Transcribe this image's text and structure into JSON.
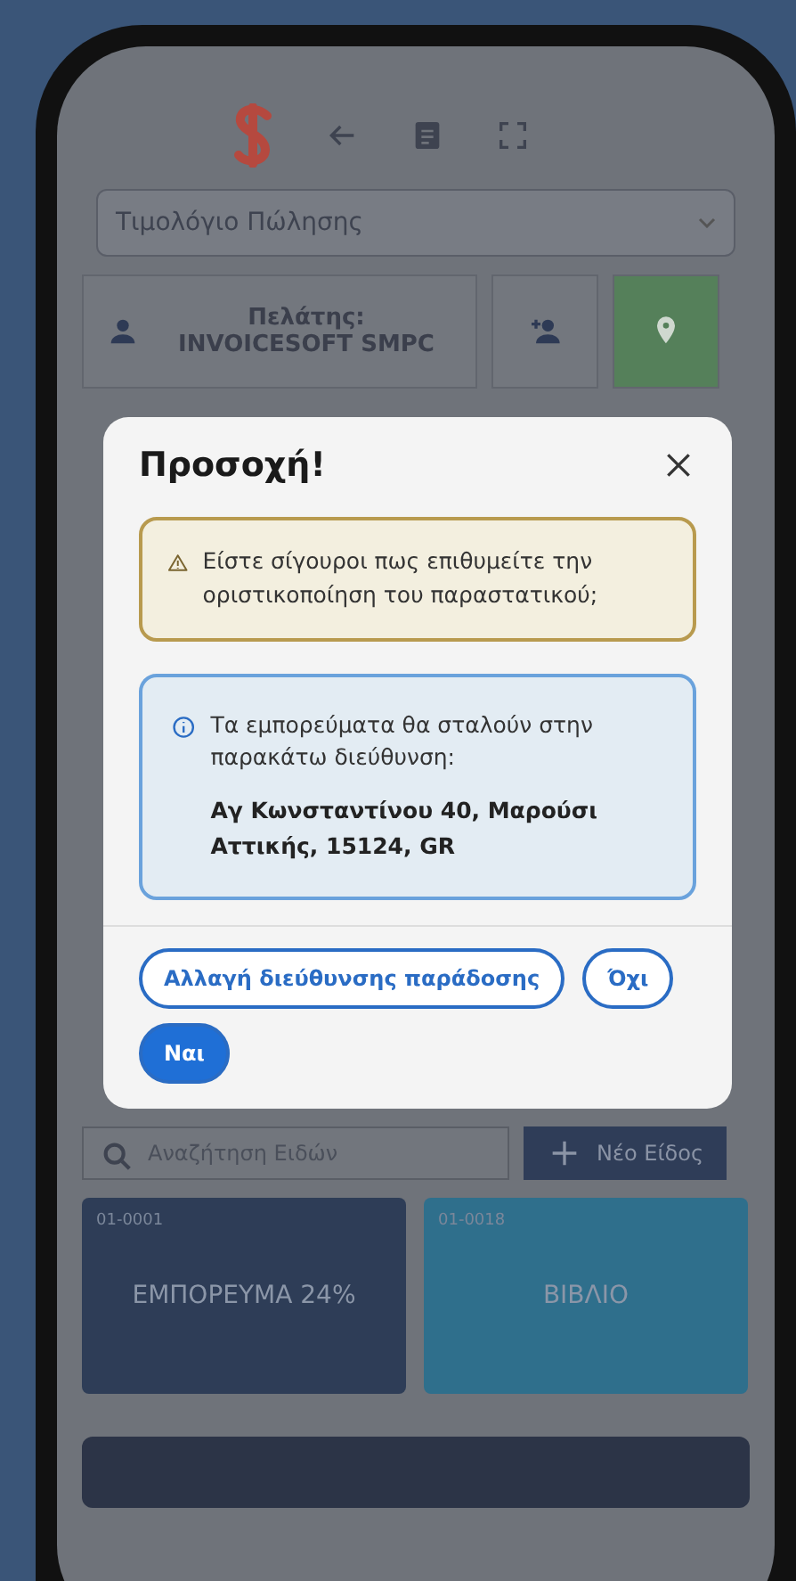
{
  "document_type": {
    "value": "Τιμολόγιο Πώλησης"
  },
  "customer": {
    "label": "Πελάτης: INVOICESOFT SMPC"
  },
  "dialog": {
    "title": "Προσοχή!",
    "warning": "Είστε σίγουροι πως επιθυμείτε την οριστικοποίηση του παραστατικού;",
    "info": "Τα εμπορεύματα θα σταλούν στην παρακάτω διεύθυνση:",
    "address": "Αγ Κωνσταντίνου 40, Μαρούσι Αττικής, 15124, GR",
    "buttons": [
      {
        "label": "Αλλαγή διεύθυνσης παράδοσης",
        "kind": "outline"
      },
      {
        "label": "Όχι",
        "kind": "outline"
      },
      {
        "label": "Ναι",
        "kind": "primary"
      }
    ]
  },
  "search": {
    "placeholder": "Αναζήτηση Ειδών"
  },
  "new_item_button": {
    "label": "Νέο Είδος"
  },
  "items": [
    {
      "code": "01-0001",
      "name": "ΕΜΠΟΡΕΥΜΑ 24%",
      "color": "#2e3d57"
    },
    {
      "code": "01-0018",
      "name": "ΒΙΒΛΙΟ",
      "color": "#2f6f8c"
    }
  ]
}
